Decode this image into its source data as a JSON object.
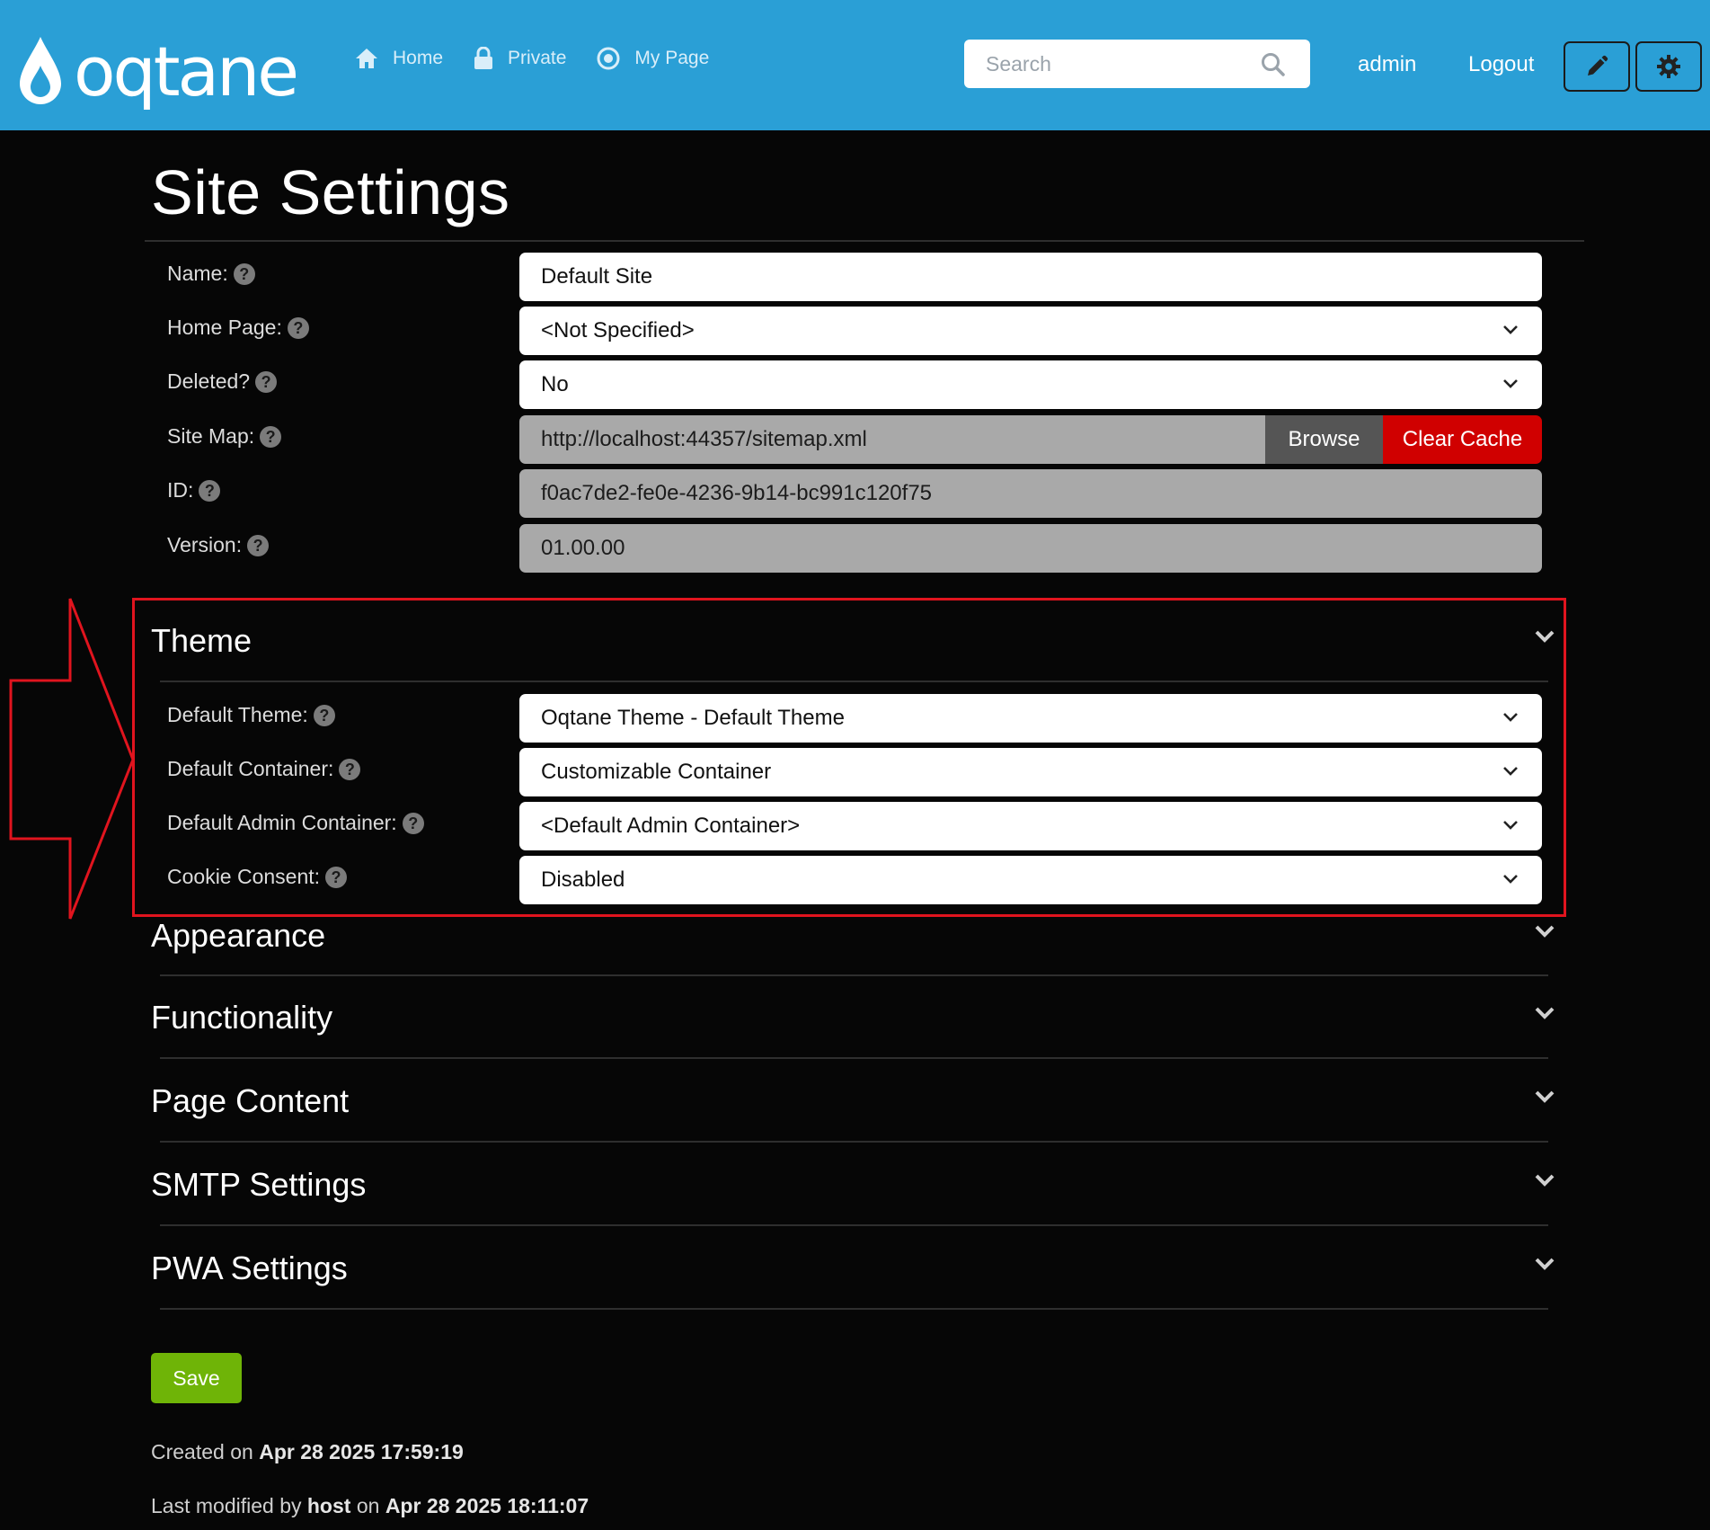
{
  "header": {
    "logo_text": "oqtane",
    "nav": [
      {
        "label": "Home",
        "icon": "home-icon"
      },
      {
        "label": "Private",
        "icon": "lock-icon"
      },
      {
        "label": "My Page",
        "icon": "target-icon"
      }
    ],
    "search_placeholder": "Search",
    "user_label": "admin",
    "logout_label": "Logout",
    "edit_icon": "pencil-icon",
    "settings_icon": "gear-icon"
  },
  "page": {
    "title": "Site Settings"
  },
  "general": {
    "name_label": "Name:",
    "name_value": "Default Site",
    "home_page_label": "Home Page:",
    "home_page_value": "<Not Specified>",
    "deleted_label": "Deleted?",
    "deleted_value": "No",
    "site_map_label": "Site Map:",
    "site_map_value": "http://localhost:44357/sitemap.xml",
    "browse_label": "Browse",
    "clear_cache_label": "Clear Cache",
    "id_label": "ID:",
    "id_value": "f0ac7de2-fe0e-4236-9b14-bc991c120f75",
    "version_label": "Version:",
    "version_value": "01.00.00"
  },
  "theme": {
    "title": "Theme",
    "default_theme_label": "Default Theme:",
    "default_theme_value": "Oqtane Theme - Default Theme",
    "default_container_label": "Default Container:",
    "default_container_value": "Customizable Container",
    "default_admin_container_label": "Default Admin Container:",
    "default_admin_container_value": "<Default Admin Container>",
    "cookie_consent_label": "Cookie Consent:",
    "cookie_consent_value": "Disabled"
  },
  "sections": [
    "Appearance",
    "Functionality",
    "Page Content",
    "SMTP Settings",
    "PWA Settings"
  ],
  "footer": {
    "save_label": "Save",
    "created_prefix": "Created on",
    "created_date": "Apr 28 2025 17:59:19",
    "modified_prefix": "Last modified by",
    "modified_user": "host",
    "modified_on": "on",
    "modified_date": "Apr 28 2025 18:11:07"
  },
  "colors": {
    "header_bg": "#2a9fd6",
    "page_bg": "#060606",
    "clear_cache": "#d00000",
    "save": "#6fb407",
    "highlight": "#e0141e"
  }
}
